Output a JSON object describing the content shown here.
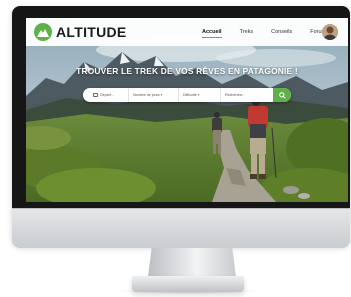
{
  "site": {
    "logo_text": "ALTITUDE",
    "nav": [
      "Accueil",
      "Treks",
      "Conseils",
      "Forum"
    ],
    "active_nav": "Accueil"
  },
  "hero": {
    "title": "TROUVER LE TREK DE VOS RÊVES EN PATAGONIE !"
  },
  "search": {
    "fields": [
      "Départ...",
      "Nombre de jours",
      "Difficulté",
      "Recherche..."
    ]
  },
  "colors": {
    "accent": "#5fb04a",
    "nav_bg": "#ffffff",
    "bezel": "#161616",
    "chin": "#d5d8db"
  },
  "icons": {
    "logo": "mountain-logo-icon",
    "search": "search-icon",
    "calendar": "calendar-icon",
    "avatar": "user-avatar"
  }
}
